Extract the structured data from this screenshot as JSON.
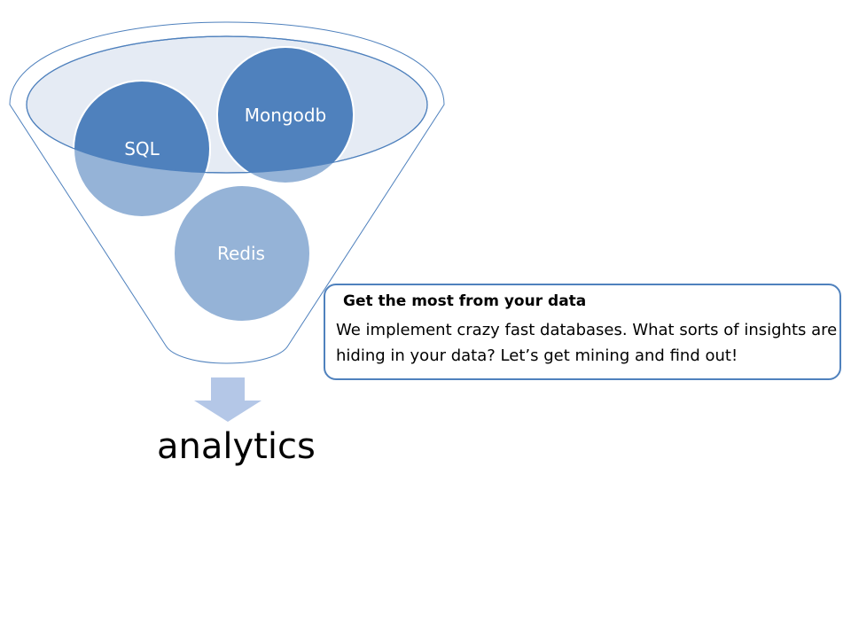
{
  "funnel": {
    "inputs": [
      {
        "label": "SQL"
      },
      {
        "label": "Mongodb"
      },
      {
        "label": "Redis"
      }
    ],
    "output_label": "analytics",
    "colors": {
      "dark_circle": "#4f81bd",
      "light_circle": "#95b3d7",
      "funnel_outline": "#4f81bd",
      "funnel_top_fill": "#e5ebf4",
      "arrow": "#b4c7e7"
    }
  },
  "callout": {
    "title": "Get the most from your data",
    "body": "We implement crazy fast databases. What sorts of insights are hiding in your data? Let’s get mining and find out!"
  }
}
